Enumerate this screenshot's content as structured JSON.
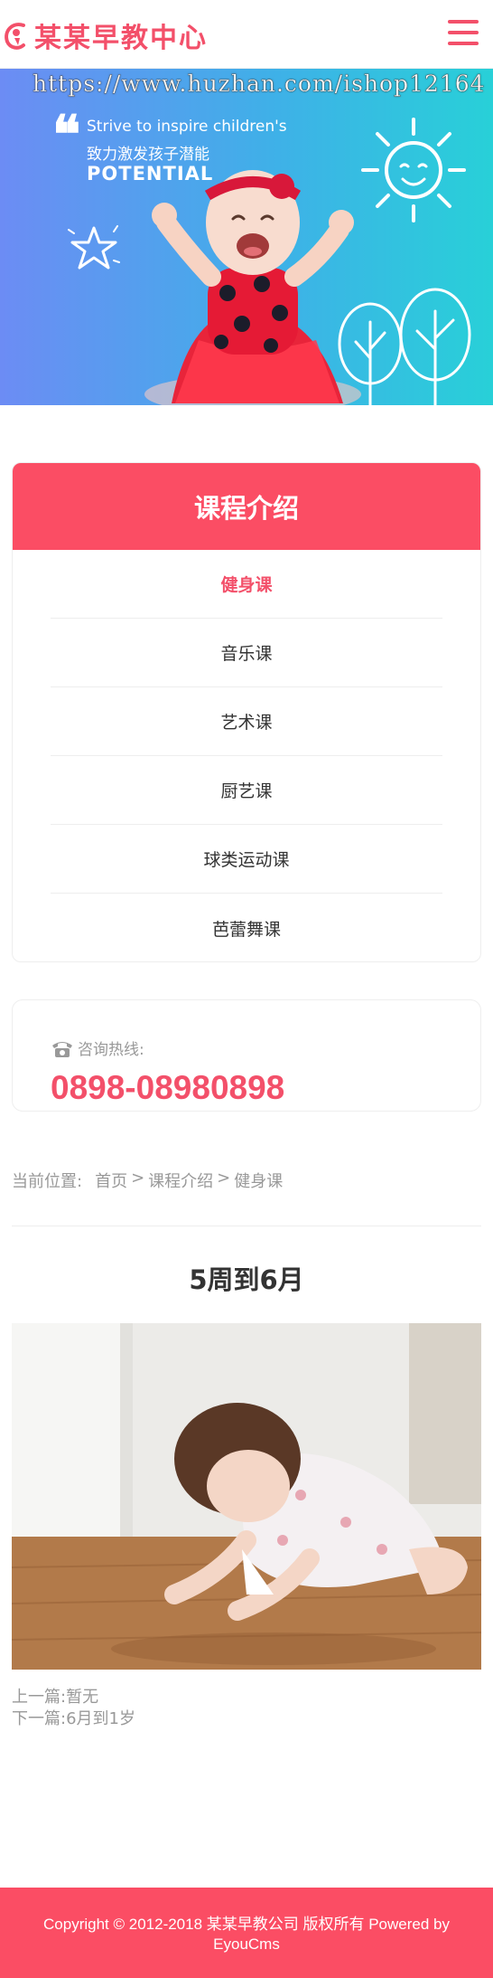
{
  "header": {
    "logo_text": "某某早教中心",
    "brand_color": "#f3506a",
    "menu_icon": "hamburger-menu-icon"
  },
  "banner": {
    "watermark": "https://www.huzhan.com/ishop12164",
    "quote_mark": "❝",
    "tagline_en": "Strive to inspire children's",
    "tagline_cn": "致力激发孩子潜能",
    "tagline_big": "POTENTIAL"
  },
  "course_panel": {
    "title": "课程介绍",
    "header_color": "#fb4d64",
    "items": [
      {
        "label": "健身课",
        "active": true
      },
      {
        "label": "音乐课",
        "active": false
      },
      {
        "label": "艺术课",
        "active": false
      },
      {
        "label": "厨艺课",
        "active": false
      },
      {
        "label": "球类运动课",
        "active": false
      },
      {
        "label": "芭蕾舞课",
        "active": false
      }
    ]
  },
  "hotline": {
    "icon": "telephone-icon",
    "label": "咨询热线:",
    "number": "0898-08980898"
  },
  "breadcrumb": {
    "label": "当前位置:",
    "items": [
      "首页",
      "课程介绍",
      "健身课"
    ],
    "separator": ">"
  },
  "article": {
    "title": "5周到6月",
    "prev_label": "上一篇:",
    "prev_value": "暂无",
    "next_label": "下一篇:",
    "next_value": "6月到1岁"
  },
  "footer": {
    "copyright": "Copyright © 2012-2018 某某早教公司 版权所有 Powered by EyouCms"
  }
}
